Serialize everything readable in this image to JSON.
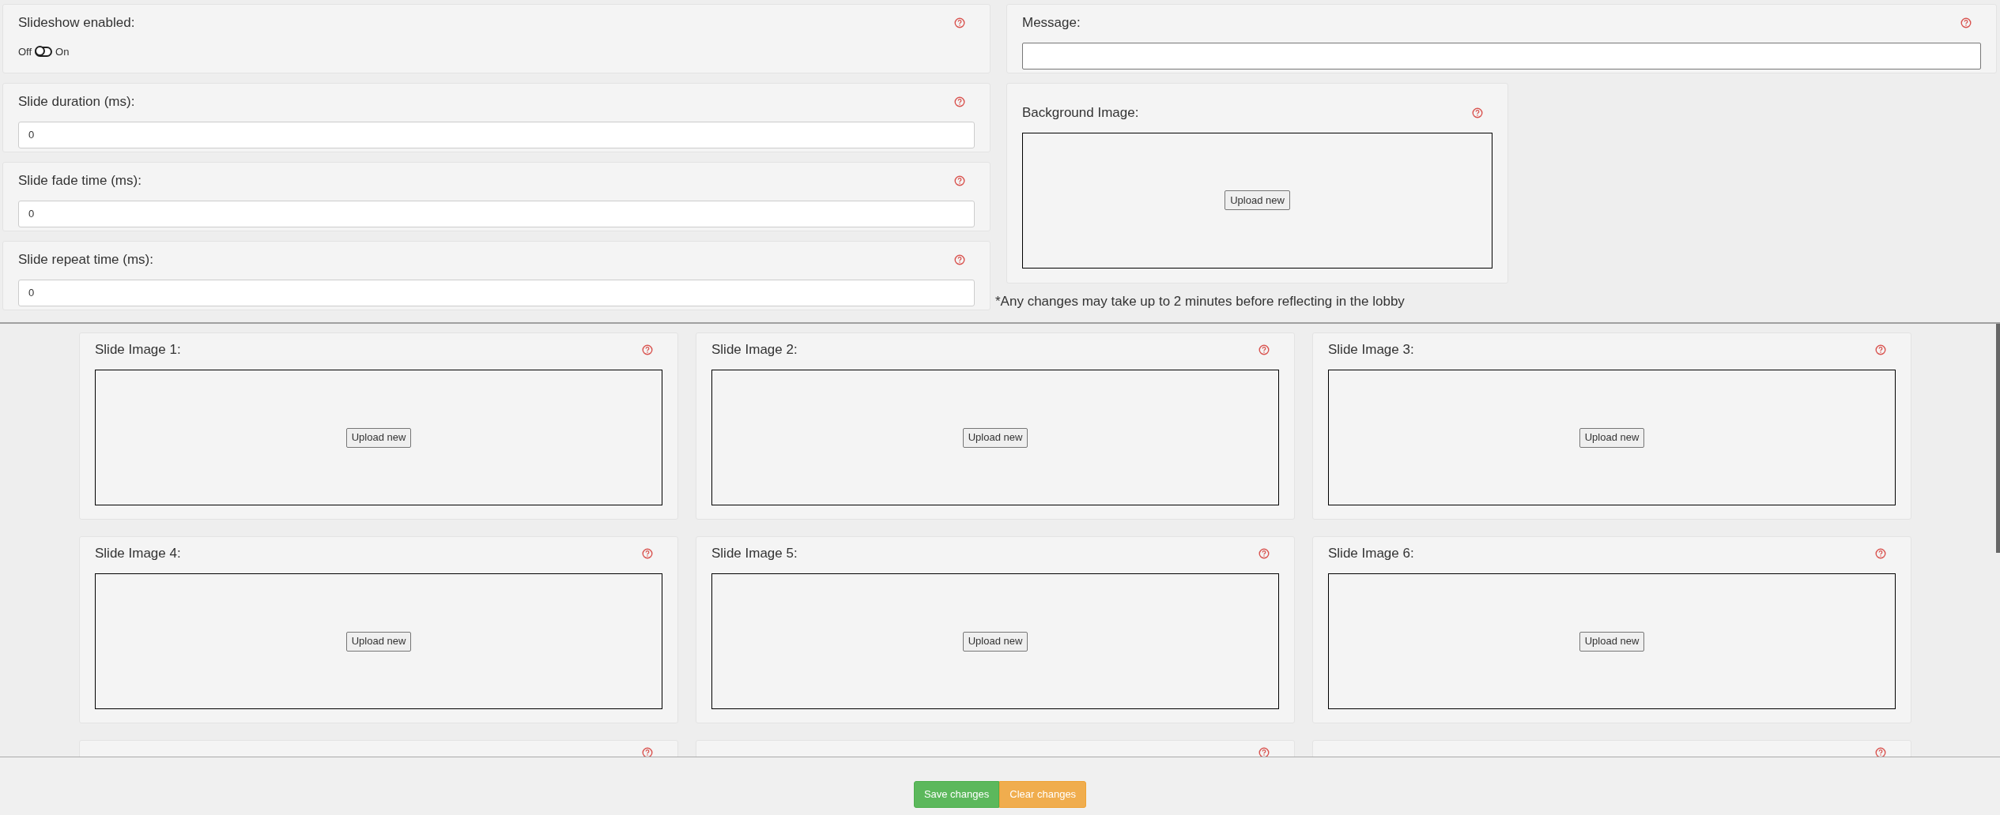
{
  "settings": [
    {
      "kind": "toggle",
      "label": "Slideshow enabled:",
      "off_label": "Off",
      "on_label": "On",
      "on": false
    },
    {
      "kind": "input",
      "label": "Slide duration (ms):",
      "value": "0"
    },
    {
      "kind": "input",
      "label": "Slide fade time (ms):",
      "value": "0"
    },
    {
      "kind": "input",
      "label": "Slide repeat time (ms):",
      "value": "0"
    }
  ],
  "message": {
    "label": "Message:"
  },
  "background": {
    "label": "Background Image:",
    "button": "Upload new"
  },
  "note": "*Any changes may take up to 2 minutes before reflecting in the lobby",
  "slides": [
    {
      "kind": "upload",
      "label": "Slide Image 1:",
      "button": "Upload new"
    },
    {
      "kind": "upload",
      "label": "Slide Image 2:",
      "button": "Upload new"
    },
    {
      "kind": "upload",
      "label": "Slide Image 3:",
      "button": "Upload new"
    },
    {
      "kind": "upload",
      "label": "Slide Image 4:",
      "button": "Upload new"
    },
    {
      "kind": "upload",
      "label": "Slide Image 5:",
      "button": "Upload new"
    },
    {
      "kind": "upload",
      "label": "Slide Image 6:",
      "button": "Upload new"
    },
    {
      "kind": "cut"
    },
    {
      "kind": "cut"
    },
    {
      "kind": "cut"
    }
  ],
  "footer": {
    "save": "Save changes",
    "clear": "Clear changes"
  }
}
